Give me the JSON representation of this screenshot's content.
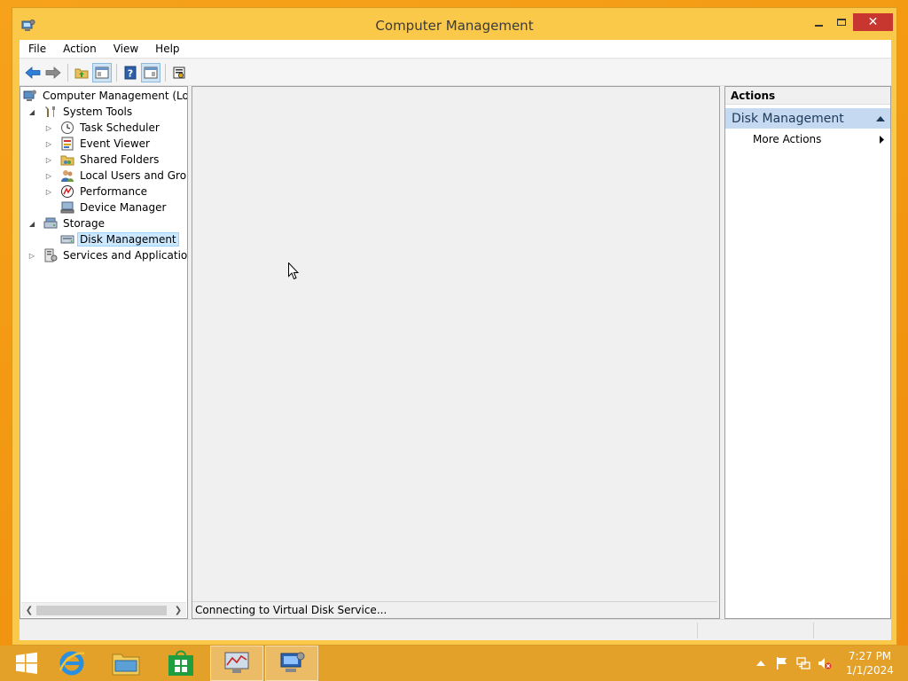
{
  "window": {
    "title": "Computer Management",
    "close_glyph": "✕"
  },
  "menu": [
    "File",
    "Action",
    "View",
    "Help"
  ],
  "toolbar": [
    "back-arrow-icon",
    "forward-arrow-icon",
    "up-folder-icon",
    "show-hide-console-tree-icon",
    "help-icon",
    "show-hide-action-pane-icon",
    "properties-icon"
  ],
  "tree": [
    {
      "label": "Computer Management (Local",
      "icon": "computer-management-icon",
      "toggle": ""
    },
    {
      "label": "System Tools",
      "icon": "system-tools-icon",
      "toggle": "◢"
    },
    {
      "label": "Task Scheduler",
      "icon": "clock-icon",
      "toggle": "▷"
    },
    {
      "label": "Event Viewer",
      "icon": "event-viewer-icon",
      "toggle": "▷"
    },
    {
      "label": "Shared Folders",
      "icon": "shared-folder-icon",
      "toggle": "▷"
    },
    {
      "label": "Local Users and Groups",
      "icon": "users-icon",
      "toggle": "▷"
    },
    {
      "label": "Performance",
      "icon": "performance-icon",
      "toggle": "▷"
    },
    {
      "label": "Device Manager",
      "icon": "device-manager-icon",
      "toggle": ""
    },
    {
      "label": "Storage",
      "icon": "storage-icon",
      "toggle": "◢"
    },
    {
      "label": "Disk Management",
      "icon": "disk-management-icon",
      "toggle": "",
      "selected": true
    },
    {
      "label": "Services and Applications",
      "icon": "services-icon",
      "toggle": "▷"
    }
  ],
  "center": {
    "status": "Connecting to Virtual Disk Service..."
  },
  "actions": {
    "header": "Actions",
    "group": "Disk Management",
    "items": [
      "More Actions"
    ]
  },
  "taskbar": {
    "apps": [
      "start-icon",
      "internet-explorer-icon",
      "file-explorer-icon",
      "store-icon",
      "performance-monitor-icon",
      "computer-management-icon"
    ],
    "tray": [
      "show-hidden-icons-icon",
      "action-center-flag-icon",
      "network-icon",
      "volume-muted-icon"
    ],
    "time": "7:27 PM",
    "date": "1/1/2024"
  },
  "colors": {
    "accent_window": "#fbc94a",
    "desktop": "#f39a12",
    "taskbar": "#e4a12a",
    "selection": "#cce8ff",
    "actions_group": "#c5daf0",
    "close_button": "#c7372f"
  }
}
